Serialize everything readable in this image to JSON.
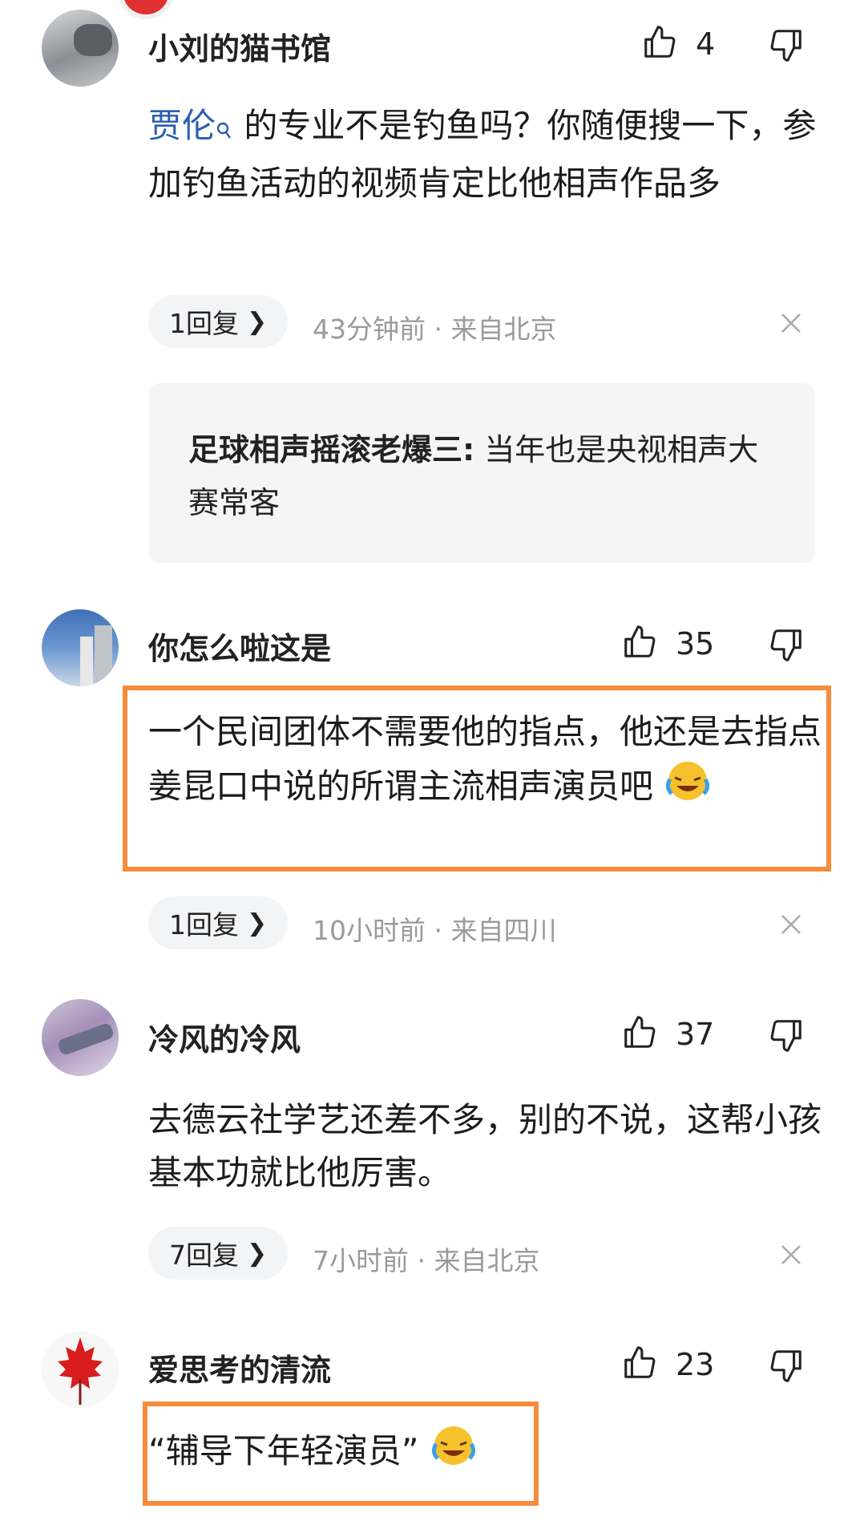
{
  "comments": [
    {
      "username": "小刘的猫书馆",
      "likes": "4",
      "mention": "贾伦",
      "text_rest": " 的专业不是钓鱼吗？你随便搜一下，参加钓鱼活动的视频肯定比他相声作品多",
      "reply_label": "1回复",
      "meta": "43分钟前 · 来自北京",
      "subreply": {
        "author": "足球相声摇滚老爆三:",
        "text": " 当年也是央视相声大赛常客"
      }
    },
    {
      "username": "你怎么啦这是",
      "likes": "35",
      "text": "一个民间团体不需要他的指点，他还是去指点姜昆口中说的所谓主流相声演员吧",
      "reply_label": "1回复",
      "meta": "10小时前 · 来自四川"
    },
    {
      "username": "冷风的冷风",
      "likes": "37",
      "text": "去德云社学艺还差不多，别的不说，这帮小孩基本功就比他厉害。",
      "reply_label": "7回复",
      "meta": "7小时前 · 来自北京"
    },
    {
      "username": "爱思考的清流",
      "likes": "23",
      "text": "“辅导下年轻演员”"
    }
  ],
  "icons": {
    "like": "thumbs-up-icon",
    "dislike": "thumbs-down-icon",
    "close": "close-icon",
    "emoji": "laughing-crying-emoji-icon",
    "search": "search-icon"
  },
  "colors": {
    "highlight": "#f58c3c",
    "mention_link": "#2a5db0",
    "meta": "#9a9a9a"
  }
}
